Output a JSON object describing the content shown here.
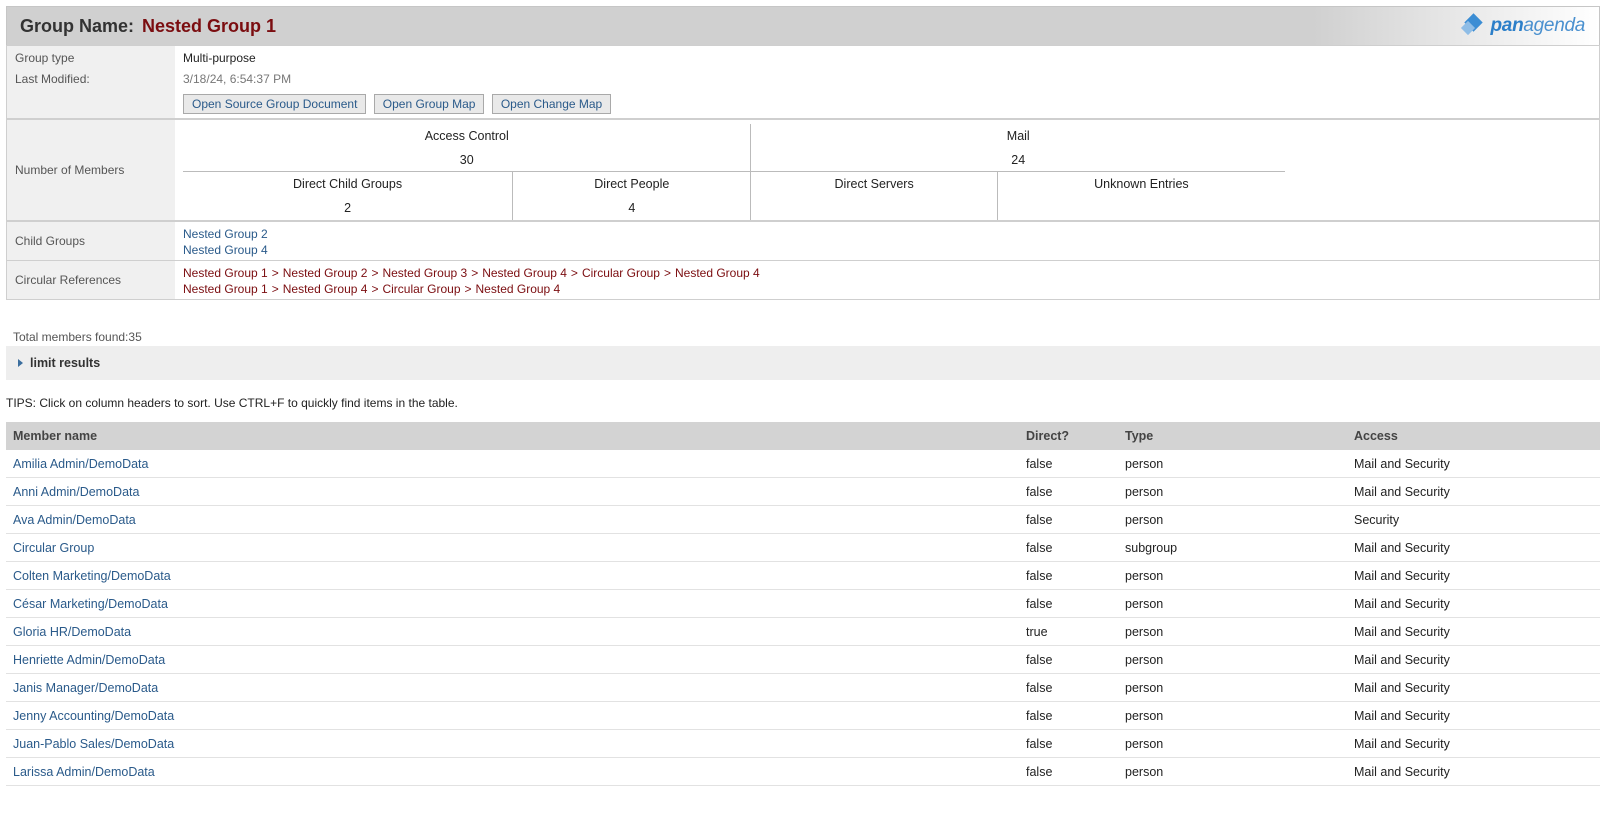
{
  "header": {
    "label": "Group Name:",
    "group_name": "Nested Group 1",
    "logo_pan": "pan",
    "logo_agenda": "agenda"
  },
  "info": {
    "group_type_label": "Group type",
    "group_type_value": "Multi-purpose",
    "last_modified_label": "Last Modified:",
    "last_modified_value": "3/18/24, 6:54:37 PM",
    "buttons": [
      "Open Source Group Document",
      "Open Group Map",
      "Open Change Map"
    ],
    "members_label": "Number of Members",
    "child_groups_label": "Child Groups",
    "circular_label": "Circular References"
  },
  "members": {
    "access_control_label": "Access Control",
    "access_control_value": "30",
    "mail_label": "Mail",
    "mail_value": "24",
    "direct_child_groups_label": "Direct Child Groups",
    "direct_child_groups_value": "2",
    "direct_people_label": "Direct People",
    "direct_people_value": "4",
    "direct_servers_label": "Direct Servers",
    "direct_servers_value": "",
    "unknown_entries_label": "Unknown Entries",
    "unknown_entries_value": ""
  },
  "child_groups": [
    "Nested Group 2",
    "Nested Group 4"
  ],
  "circular_refs": [
    [
      "Nested Group 1",
      "Nested Group 2",
      "Nested Group 3",
      "Nested Group 4",
      "Circular Group",
      "Nested Group 4"
    ],
    [
      "Nested Group 1",
      "Nested Group 4",
      "Circular Group",
      "Nested Group 4"
    ]
  ],
  "circular_separator": ">",
  "total_members": "Total members found:35",
  "limit_results": "limit results",
  "tips": "TIPS: Click on column headers to sort. Use CTRL+F to quickly find items in the table.",
  "table": {
    "columns": [
      "Member name",
      "Direct?",
      "Type",
      "Access"
    ],
    "rows": [
      [
        "Amilia Admin/DemoData",
        "false",
        "person",
        "Mail and Security"
      ],
      [
        "Anni Admin/DemoData",
        "false",
        "person",
        "Mail and Security"
      ],
      [
        "Ava Admin/DemoData",
        "false",
        "person",
        "Security"
      ],
      [
        "Circular Group",
        "false",
        "subgroup",
        "Mail and Security"
      ],
      [
        "Colten Marketing/DemoData",
        "false",
        "person",
        "Mail and Security"
      ],
      [
        "César Marketing/DemoData",
        "false",
        "person",
        "Mail and Security"
      ],
      [
        "Gloria HR/DemoData",
        "true",
        "person",
        "Mail and Security"
      ],
      [
        "Henriette Admin/DemoData",
        "false",
        "person",
        "Mail and Security"
      ],
      [
        "Janis Manager/DemoData",
        "false",
        "person",
        "Mail and Security"
      ],
      [
        "Jenny Accounting/DemoData",
        "false",
        "person",
        "Mail and Security"
      ],
      [
        "Juan-Pablo Sales/DemoData",
        "false",
        "person",
        "Mail and Security"
      ],
      [
        "Larissa Admin/DemoData",
        "false",
        "person",
        "Mail and Security"
      ]
    ]
  },
  "colors": {
    "header_bg": "#d0d0d0",
    "group_name": "#7b0d10",
    "link": "#2a5a8a",
    "circular": "#7b0d10",
    "logo": "#2c7fc9"
  }
}
